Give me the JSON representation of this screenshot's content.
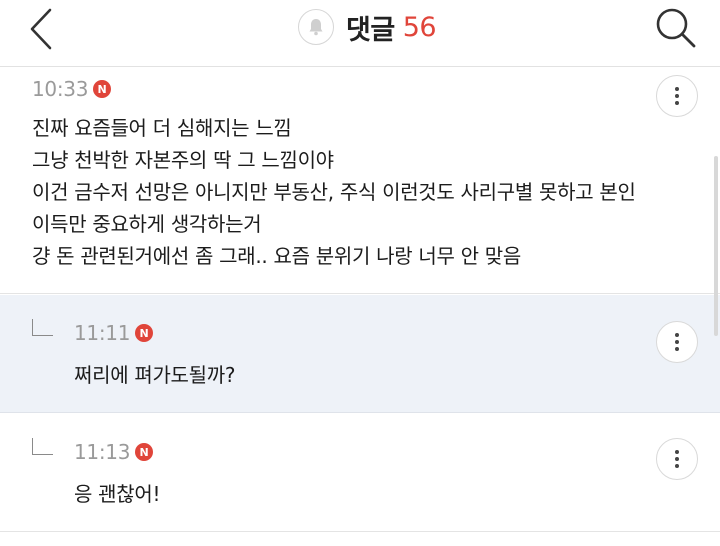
{
  "header": {
    "title": "댓글",
    "count": "56"
  },
  "comments": [
    {
      "time": "10:33",
      "badge": "N",
      "lines": [
        "진짜 요즘들어 더 심해지는 느낌",
        "그냥 천박한 자본주의 딱 그 느낌이야",
        "이건 금수저 선망은 아니지만 부동산, 주식 이런것도 사리구별 못하고 본인",
        "이득만 중요하게 생각하는거",
        "걍 돈 관련된거에선 좀 그래.. 요즘 분위기 나랑 너무 안 맞음"
      ]
    }
  ],
  "replies": [
    {
      "time": "11:11",
      "badge": "N",
      "text": "쩌리에 펴가도될까?"
    },
    {
      "time": "11:13",
      "badge": "N",
      "text": "응 괜찮어!"
    }
  ],
  "icons": {
    "back": "chevron-left-icon",
    "bell": "bell-icon",
    "search": "search-icon",
    "more": "more-vertical-icon",
    "reply": "reply-arrow-icon"
  },
  "colors": {
    "accent": "#e0453a",
    "reply_bg": "#eef2f8"
  }
}
